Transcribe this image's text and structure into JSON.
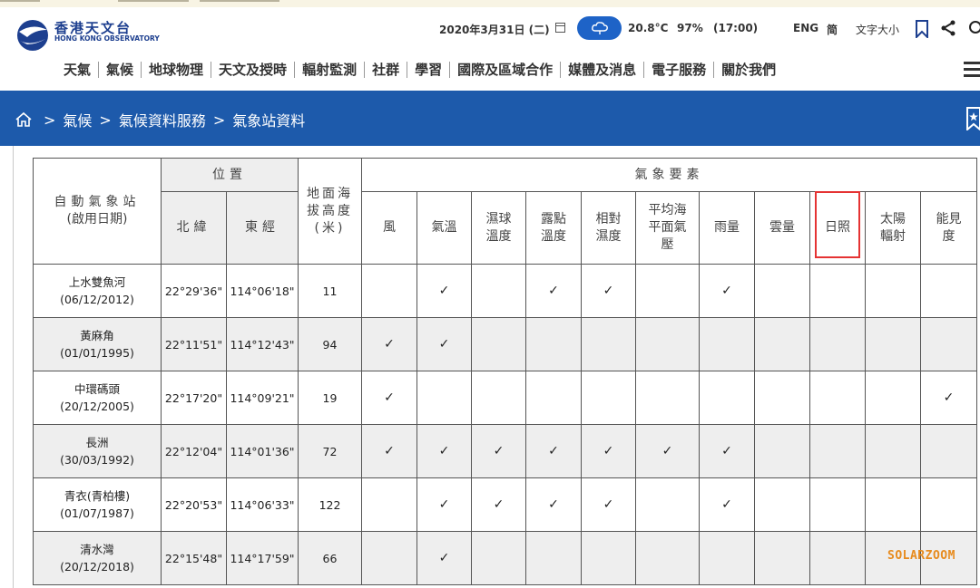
{
  "header": {
    "logo_cn": "香港天文台",
    "logo_en": "HONG KONG OBSERVATORY",
    "date": "2020年3月31日 (二)",
    "temperature": "20.8°C",
    "humidity": "97%",
    "time": "(17:00)",
    "lang_eng": "ENG",
    "lang_simplified": "简",
    "font_size": "文字大小"
  },
  "nav": [
    "天氣",
    "氣候",
    "地球物理",
    "天文及授時",
    "輻射監測",
    "社群",
    "學習",
    "國際及區域合作",
    "媒體及消息",
    "電子服務",
    "關於我們"
  ],
  "breadcrumb": [
    "氣候",
    "氣候資料服務",
    "氣象站資料"
  ],
  "table": {
    "station_header": [
      "自動氣象站",
      "(啟用日期)"
    ],
    "position_header": "位置",
    "lat_header": "北緯",
    "lon_header": "東經",
    "altitude_header": [
      "地面海",
      "拔高度",
      "(米)"
    ],
    "elements_header": "氣象要素",
    "element_cols": [
      [
        "風"
      ],
      [
        "氣溫"
      ],
      [
        "濕球",
        "溫度"
      ],
      [
        "露點",
        "溫度"
      ],
      [
        "相對",
        "濕度"
      ],
      [
        "平均海",
        "平面氣",
        "壓"
      ],
      [
        "雨量"
      ],
      [
        "雲量"
      ],
      [
        "日照"
      ],
      [
        "太陽",
        "輻射"
      ],
      [
        "能見",
        "度"
      ]
    ],
    "check_symbol": "✓",
    "rows": [
      {
        "name": "上水雙魚河",
        "date": "(06/12/2012)",
        "lat": "22°29'36\"",
        "lon": "114°06'18\"",
        "alt": "11",
        "checks": [
          false,
          true,
          false,
          true,
          true,
          false,
          true,
          false,
          false,
          false,
          false
        ]
      },
      {
        "name": "黃麻角",
        "date": "(01/01/1995)",
        "lat": "22°11'51\"",
        "lon": "114°12'43\"",
        "alt": "94",
        "checks": [
          true,
          true,
          false,
          false,
          false,
          false,
          false,
          false,
          false,
          false,
          false
        ]
      },
      {
        "name": "中環碼頭",
        "date": "(20/12/2005)",
        "lat": "22°17'20\"",
        "lon": "114°09'21\"",
        "alt": "19",
        "checks": [
          true,
          false,
          false,
          false,
          false,
          false,
          false,
          false,
          false,
          false,
          true
        ]
      },
      {
        "name": "長洲",
        "date": "(30/03/1992)",
        "lat": "22°12'04\"",
        "lon": "114°01'36\"",
        "alt": "72",
        "checks": [
          true,
          true,
          true,
          true,
          true,
          true,
          true,
          false,
          false,
          false,
          false
        ]
      },
      {
        "name": "青衣(青柏樓)",
        "date": "(01/07/1987)",
        "lat": "22°20'53\"",
        "lon": "114°06'33\"",
        "alt": "122",
        "checks": [
          false,
          true,
          true,
          true,
          true,
          false,
          true,
          false,
          false,
          false,
          false
        ]
      },
      {
        "name": "清水灣",
        "date": "(20/12/2018)",
        "lat": "22°15'48\"",
        "lon": "114°17'59\"",
        "alt": "66",
        "checks": [
          false,
          true,
          false,
          false,
          false,
          false,
          false,
          false,
          false,
          false,
          false
        ]
      }
    ]
  },
  "watermark": "SOLARZOOM",
  "colors": {
    "brand_blue": "#1d5aab",
    "highlight_red": "#e53333",
    "watermark_orange": "#e78b1e"
  }
}
